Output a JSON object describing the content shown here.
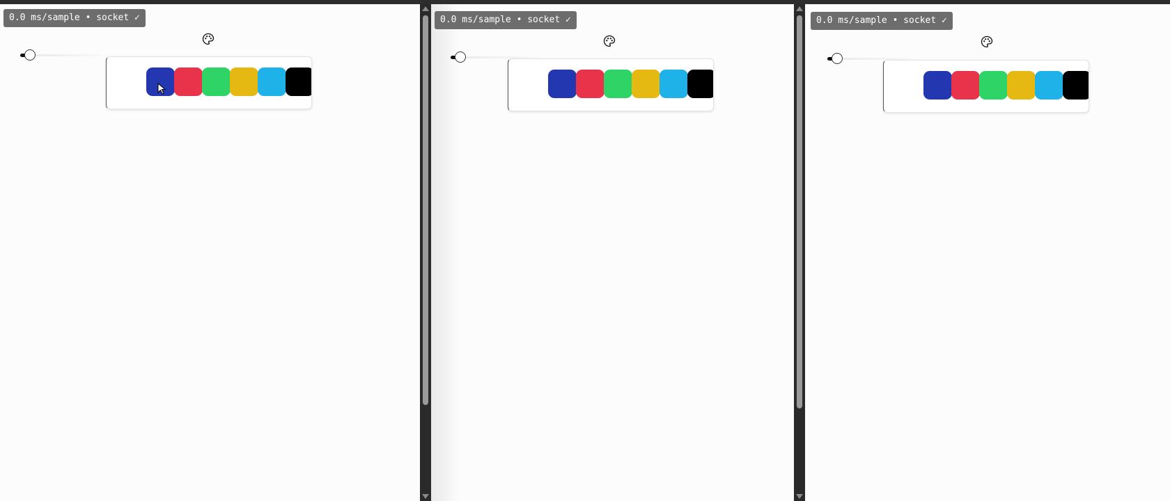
{
  "status_text": "0.0 ms/sample • socket ✓",
  "icons": {
    "palette": "palette-icon",
    "cursor": "mouse-pointer-icon"
  },
  "slider": {
    "value_fraction": 0.05
  },
  "swatches": [
    {
      "name": "blue",
      "color": "#2237b0"
    },
    {
      "name": "red",
      "color": "#e8334b"
    },
    {
      "name": "green",
      "color": "#2ed466"
    },
    {
      "name": "yellow",
      "color": "#e5b812"
    },
    {
      "name": "cyan",
      "color": "#1fb2e8"
    },
    {
      "name": "black",
      "color": "#000000"
    }
  ],
  "panes": [
    {
      "id": "pane-1",
      "status": "0.0 ms/sample • socket ✓"
    },
    {
      "id": "pane-2",
      "status": "0.0 ms/sample • socket ✓"
    },
    {
      "id": "pane-3",
      "status": "0.0 ms/sample • socket ✓"
    }
  ],
  "colors": {
    "badge_bg": "#6d6d6d",
    "page_bg": "#fcfcfc",
    "divider": "#2a2a2a"
  }
}
